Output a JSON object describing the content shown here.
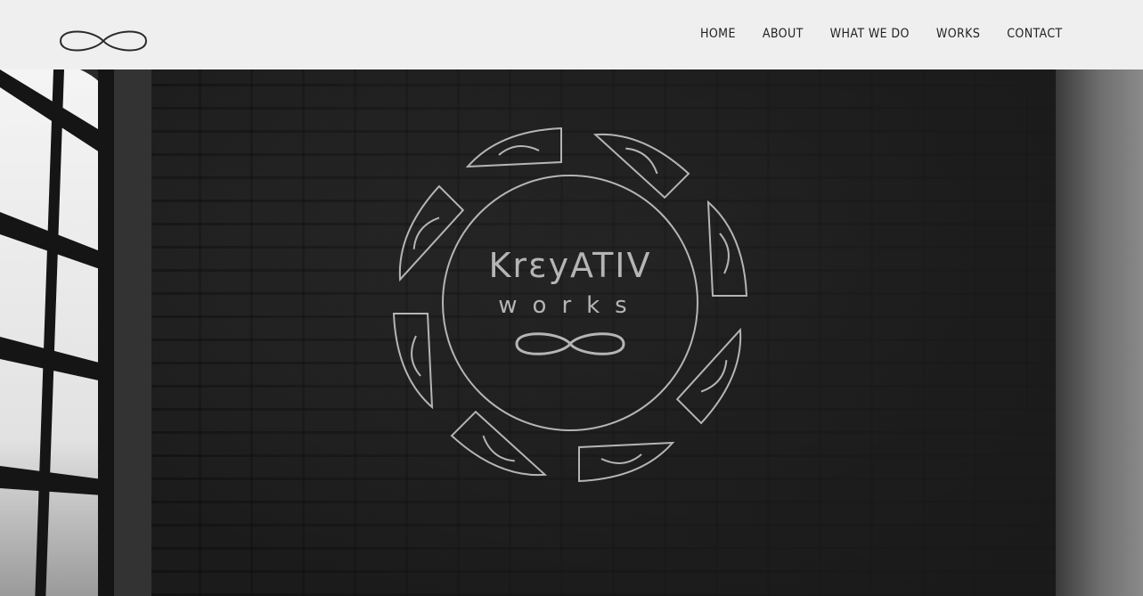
{
  "header": {
    "logo_icon": "infinity-icon",
    "nav": [
      {
        "label": "HOME"
      },
      {
        "label": "ABOUT"
      },
      {
        "label": "WHAT WE DO"
      },
      {
        "label": "WORKS"
      },
      {
        "label": "CONTACT"
      }
    ]
  },
  "hero": {
    "brand_line1": "KrεyATIV",
    "brand_line2": "works",
    "emblem_icon": "infinity-icon"
  },
  "colors": {
    "header_bg": "#efefef",
    "nav_text": "#222222",
    "emblem_stroke": "#b5b5b5"
  }
}
